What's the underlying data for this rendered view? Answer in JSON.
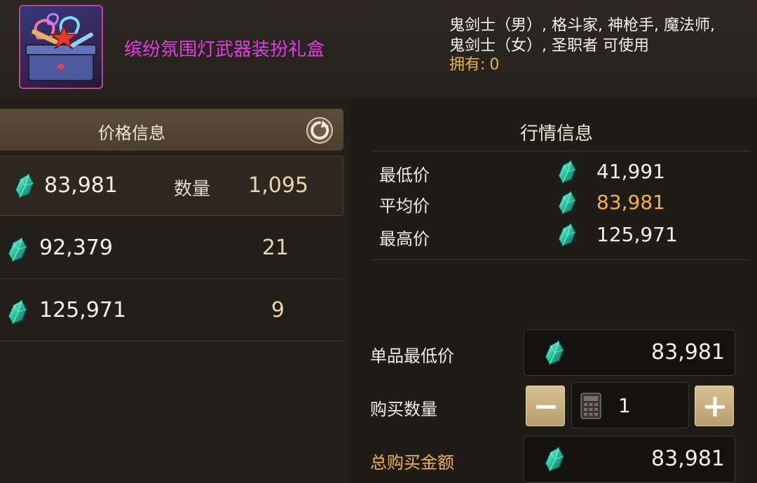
{
  "item": {
    "name": "缤纷氛围灯武器装扮礼盒",
    "classes_line1": "鬼剑士（男）, 格斗家, 神枪手, 魔法师,",
    "classes_line2": "鬼剑士（女）, 圣职者 可使用",
    "owned_label": "拥有:",
    "owned_value": "0",
    "icon": "gift-box-icon"
  },
  "price_info": {
    "title": "价格信息",
    "refresh_icon": "refresh-icon",
    "qty_label": "数量",
    "currency_icon": "gem-icon",
    "listings": [
      {
        "price": "83,981",
        "quantity": "1,095"
      },
      {
        "price": "92,379",
        "quantity": "21"
      },
      {
        "price": "125,971",
        "quantity": "9"
      }
    ]
  },
  "market_info": {
    "title": "行情信息",
    "min_label": "最低价",
    "min_value": "41,991",
    "avg_label": "平均价",
    "avg_value": "83,981",
    "max_label": "最高价",
    "max_value": "125,971"
  },
  "purchase": {
    "unit_min_label": "单品最低价",
    "unit_min_value": "83,981",
    "qty_label": "购买数量",
    "qty_value": "1",
    "minus_label": "−",
    "plus_label": "+",
    "total_label": "总购买金额",
    "total_value": "83,981",
    "calculator_icon": "calculator-icon"
  },
  "colors": {
    "item_name": "#e53ae4",
    "gold": "#f0b34a",
    "gem": "#27c7a6"
  }
}
